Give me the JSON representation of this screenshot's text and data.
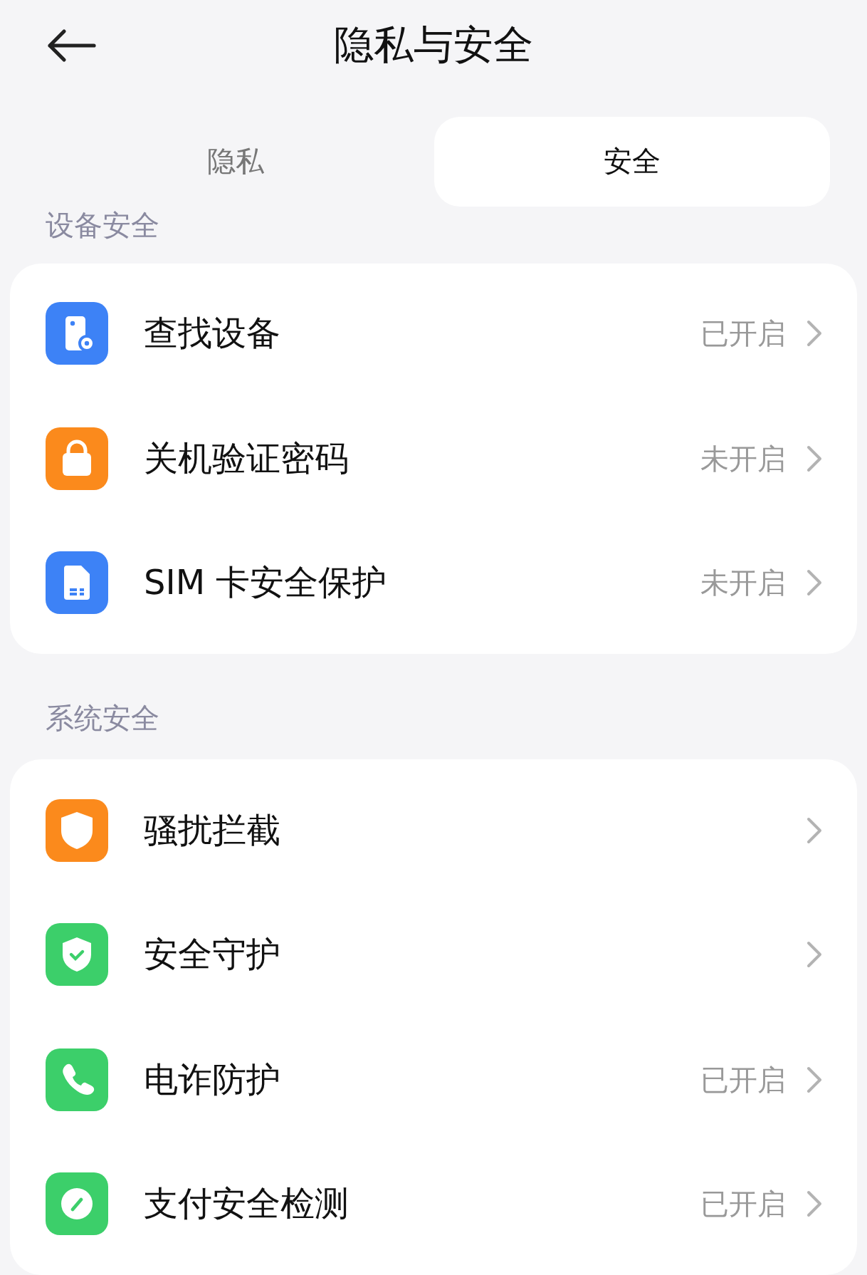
{
  "header": {
    "title": "隐私与安全"
  },
  "tabs": [
    {
      "label": "隐私",
      "selected": false
    },
    {
      "label": "安全",
      "selected": true
    }
  ],
  "sections": [
    {
      "title": "设备安全",
      "items": [
        {
          "label": "查找设备",
          "status": "已开启",
          "kind": "locate",
          "color": "#3d82f6"
        },
        {
          "label": "关机验证密码",
          "status": "未开启",
          "kind": "lock",
          "color": "#fb8a1c"
        },
        {
          "label": "SIM 卡安全保护",
          "status": "未开启",
          "kind": "sim",
          "color": "#3d82f6"
        }
      ]
    },
    {
      "title": "系统安全",
      "items": [
        {
          "label": "骚扰拦截",
          "kind": "shield",
          "color": "#fb8a1c"
        },
        {
          "label": "安全守护",
          "kind": "shieldcheck",
          "color": "#3ccf6a"
        },
        {
          "label": "电诈防护",
          "status": "已开启",
          "kind": "phone",
          "color": "#3ccf6a"
        },
        {
          "label": "支付安全检测",
          "status": "已开启",
          "kind": "gauge",
          "color": "#3ccf6a"
        }
      ]
    }
  ]
}
